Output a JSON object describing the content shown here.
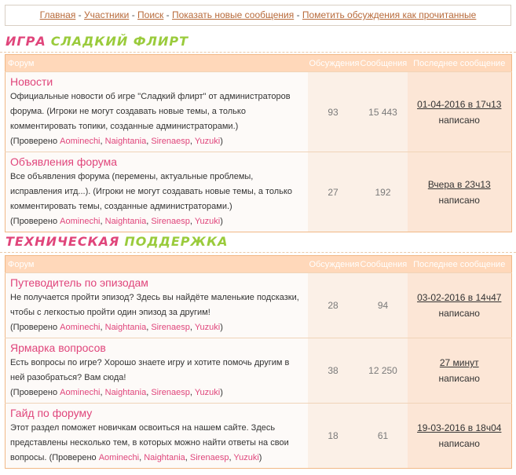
{
  "nav": {
    "links": [
      "Главная",
      "Участники",
      "Поиск",
      "Показать новые сообщения",
      "Пометить обсуждения как прочитанные"
    ],
    "separator": "-"
  },
  "headers": {
    "forum": "Форум",
    "topics": "Обсуждения",
    "posts": "Сообщения",
    "last": "Последнее сообщение"
  },
  "labels": {
    "checked_prefix": "(Проверено",
    "checked_suffix": ")",
    "comma": ",",
    "written": "написано"
  },
  "moderators": [
    "Aominechi",
    "Naightania",
    "Sirenaesp",
    "Yuzuki"
  ],
  "sections": [
    {
      "title_part1": "Игра",
      "title_part2": "Сладкий флирт",
      "forums": [
        {
          "name": "Новости",
          "desc": "Официальные новости об игре \"Сладкий флирт\" от администраторов форума. (Игроки не могут создавать новые темы, а только комментировать топики, созданные администраторами.)",
          "topics": "93",
          "posts": "15 443",
          "last_date": "01-04-2016 в 17ч13"
        },
        {
          "name": "Объявления форума",
          "desc": "Все объявления форума (перемены, актуальные проблемы, исправления итд...). (Игроки не могут создавать новые темы, а только комментировать темы, созданные администраторами.)",
          "topics": "27",
          "posts": "192",
          "last_date": "Вчера в 23ч13"
        }
      ]
    },
    {
      "title_part1": "Техническая",
      "title_part2": "поддержка",
      "forums": [
        {
          "name": "Путеводитель по эпизодам",
          "desc": "Не получается пройти эпизод? Здесь вы найдёте маленькие подсказки, чтобы с легкостью пройти один эпизод за другим!",
          "topics": "28",
          "posts": "94",
          "last_date": "03-02-2016 в 14ч47"
        },
        {
          "name": "Ярмарка вопросов",
          "desc": "Есть вопросы по игре? Хорошо знаете игру и хотите помочь другим в ней разобраться? Вам сюда!",
          "topics": "38",
          "posts": "12 250",
          "last_date": "27 минут"
        },
        {
          "name": "Гайд по форуму",
          "desc": "Этот раздел поможет новичкам освоиться на нашем сайте. Здесь представлены несколько тем, в которых можно найти ответы на свои вопросы.",
          "topics": "18",
          "posts": "61",
          "last_date": "19-03-2016 в 18ч04"
        }
      ]
    }
  ]
}
